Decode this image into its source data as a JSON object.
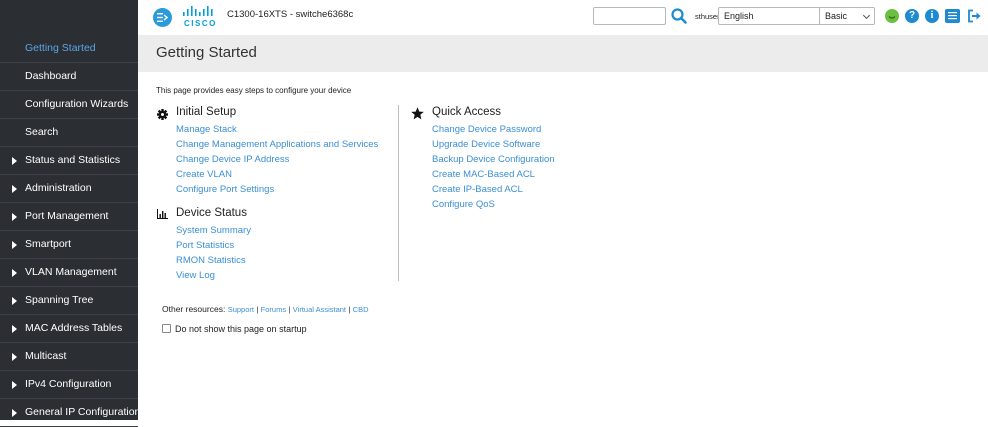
{
  "sidebar": {
    "items": [
      {
        "label": "Getting Started",
        "active": true,
        "expandable": false
      },
      {
        "label": "Dashboard",
        "active": false,
        "expandable": false
      },
      {
        "label": "Configuration Wizards",
        "active": false,
        "expandable": false
      },
      {
        "label": "Search",
        "active": false,
        "expandable": false
      },
      {
        "label": "Status and Statistics",
        "active": false,
        "expandable": true
      },
      {
        "label": "Administration",
        "active": false,
        "expandable": true
      },
      {
        "label": "Port Management",
        "active": false,
        "expandable": true
      },
      {
        "label": "Smartport",
        "active": false,
        "expandable": true
      },
      {
        "label": "VLAN Management",
        "active": false,
        "expandable": true
      },
      {
        "label": "Spanning Tree",
        "active": false,
        "expandable": true
      },
      {
        "label": "MAC Address Tables",
        "active": false,
        "expandable": true
      },
      {
        "label": "Multicast",
        "active": false,
        "expandable": true
      },
      {
        "label": "IPv4 Configuration",
        "active": false,
        "expandable": true
      },
      {
        "label": "General IP Configuration",
        "active": false,
        "expandable": true
      }
    ]
  },
  "header": {
    "logo_text": "CISCO",
    "device_title": "C1300-16XTS - switche6368c",
    "search": {
      "value": "",
      "placeholder": ""
    },
    "username": "sthuser",
    "language": {
      "selected": "English"
    },
    "mode": {
      "selected": "Basic"
    },
    "icons": [
      "menu-toggle-icon",
      "cisco-logo",
      "search-icon",
      "status-icon",
      "help-icon",
      "info-icon",
      "display-icon",
      "logout-icon"
    ],
    "help_glyph": "?",
    "info_glyph": "i"
  },
  "page": {
    "title": "Getting Started",
    "intro": "This page provides easy steps to configure your device"
  },
  "sections": {
    "initial_setup": {
      "title": "Initial Setup",
      "icon": "gear-icon",
      "links": [
        "Manage Stack",
        "Change Management Applications and Services",
        "Change Device IP Address",
        "Create VLAN",
        "Configure Port Settings"
      ]
    },
    "device_status": {
      "title": "Device Status",
      "icon": "bar-chart-icon",
      "links": [
        "System Summary",
        "Port Statistics",
        "RMON Statistics",
        "View Log"
      ]
    },
    "quick_access": {
      "title": "Quick Access",
      "icon": "star-icon",
      "links": [
        "Change Device Password",
        "Upgrade Device Software",
        "Backup Device Configuration",
        "Create MAC-Based ACL",
        "Create IP-Based ACL",
        "Configure QoS"
      ]
    }
  },
  "other_resources": {
    "label": "Other resources:",
    "links": [
      "Support",
      "Forums",
      "Virtual Assistant",
      "CBD"
    ],
    "separator": "|"
  },
  "startup_checkbox": {
    "label": "Do not show this page on startup",
    "checked": false
  },
  "colors": {
    "sidebar_bg": "#2b2e33",
    "active_item": "#5aa6e6",
    "link": "#3b8fd4",
    "accent": "#1e8bd0",
    "status_ok": "#6abf40",
    "page_header_bg": "#ececec"
  }
}
